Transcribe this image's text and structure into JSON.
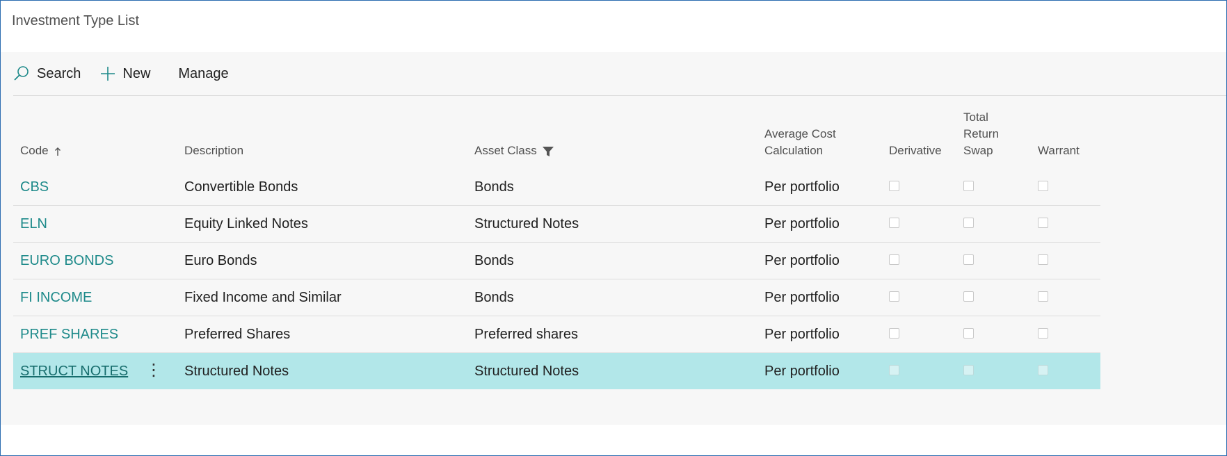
{
  "page": {
    "title": "Investment Type List"
  },
  "actions": {
    "search": "Search",
    "new": "New",
    "manage": "Manage"
  },
  "columns": {
    "code": "Code",
    "description": "Description",
    "asset_class": "Asset Class",
    "avg_cost": "Average Cost Calculation",
    "derivative": "Derivative",
    "trs": "Total Return Swap",
    "warrant": "Warrant"
  },
  "sort_icon": "arrow-up-icon",
  "filter_icon": "funnel-icon",
  "rows": [
    {
      "code": "CBS",
      "description": "Convertible Bonds",
      "asset_class": "Bonds",
      "avg_cost": "Per portfolio",
      "derivative": false,
      "trs": false,
      "warrant": false
    },
    {
      "code": "ELN",
      "description": "Equity Linked Notes",
      "asset_class": "Structured Notes",
      "avg_cost": "Per portfolio",
      "derivative": false,
      "trs": false,
      "warrant": false
    },
    {
      "code": "EURO BONDS",
      "description": "Euro Bonds",
      "asset_class": "Bonds",
      "avg_cost": "Per portfolio",
      "derivative": false,
      "trs": false,
      "warrant": false
    },
    {
      "code": "FI INCOME",
      "description": "Fixed Income and Similar",
      "asset_class": "Bonds",
      "avg_cost": "Per portfolio",
      "derivative": false,
      "trs": false,
      "warrant": false
    },
    {
      "code": "PREF SHARES",
      "description": "Preferred Shares",
      "asset_class": "Preferred shares",
      "avg_cost": "Per portfolio",
      "derivative": false,
      "trs": false,
      "warrant": false
    },
    {
      "code": "STRUCT NOTES",
      "description": "Structured Notes",
      "asset_class": "Structured Notes",
      "avg_cost": "Per portfolio",
      "derivative": false,
      "trs": false,
      "warrant": false,
      "selected": true
    }
  ],
  "colors": {
    "link": "#1e8a8a",
    "selected_row": "#b2e7e9",
    "frame_border": "#2b6cb0"
  }
}
